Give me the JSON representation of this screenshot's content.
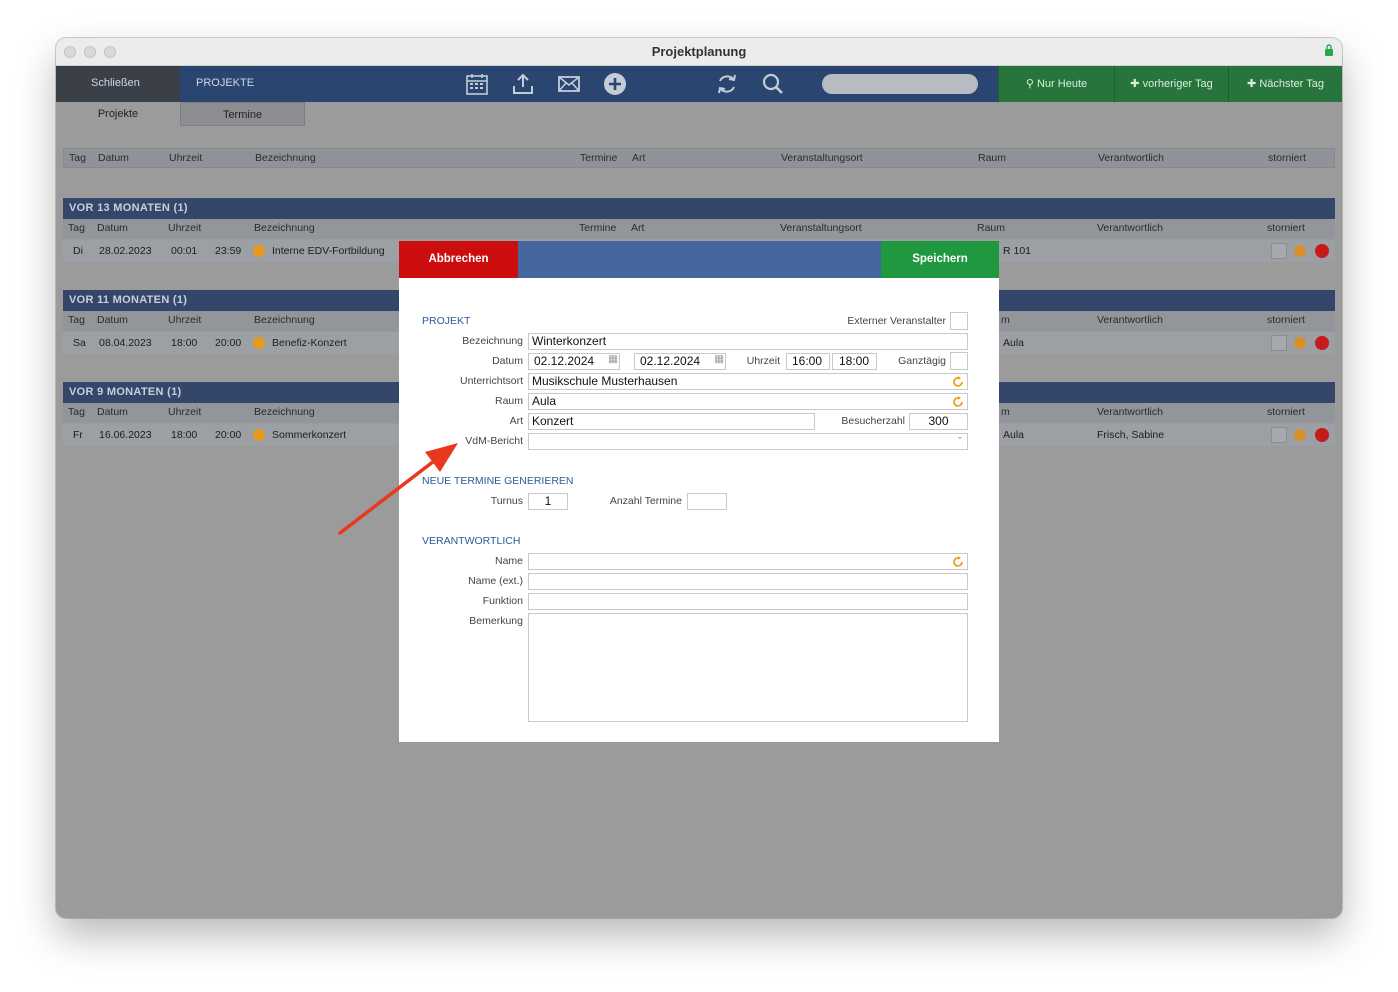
{
  "window": {
    "title": "Projektplanung"
  },
  "toolbar": {
    "close_label": "Schließen",
    "section_label": "PROJEKTE",
    "nur_heute": "Nur Heute",
    "prev_day": "vorheriger Tag",
    "next_day": "Nächster Tag",
    "search_placeholder": ""
  },
  "subtabs": {
    "projekte": "Projekte",
    "termine": "Termine"
  },
  "columns": {
    "tag": "Tag",
    "datum": "Datum",
    "uhrzeit": "Uhrzeit",
    "bezeichnung": "Bezeichnung",
    "termine": "Termine",
    "art": "Art",
    "veranstaltungsort": "Veranstaltungsort",
    "raum": "Raum",
    "verantwortlich": "Verantwortlich",
    "storniert": "storniert",
    "raum_clipped": "m"
  },
  "groups": [
    {
      "title": "VOR 13 MONATEN (1)",
      "row": {
        "tag": "Di",
        "datum": "28.02.2023",
        "start": "00:01",
        "end": "23:59",
        "bezeichnung": "Interne EDV-Fortbildung",
        "raum": "R 101",
        "verantwortlich": ""
      }
    },
    {
      "title": "VOR 11 MONATEN (1)",
      "row": {
        "tag": "Sa",
        "datum": "08.04.2023",
        "start": "18:00",
        "end": "20:00",
        "bezeichnung": "Benefiz-Konzert",
        "raum": "Aula",
        "verantwortlich": ""
      }
    },
    {
      "title": "VOR 9 MONATEN (1)",
      "row": {
        "tag": "Fr",
        "datum": "16.06.2023",
        "start": "18:00",
        "end": "20:00",
        "bezeichnung": "Sommerkonzert",
        "raum": "Aula",
        "verantwortlich": "Frisch, Sabine"
      }
    }
  ],
  "modal": {
    "cancel": "Abbrechen",
    "save": "Speichern",
    "section_projekt": "PROJEKT",
    "externer_label": "Externer Veranstalter",
    "bezeichnung_label": "Bezeichnung",
    "bezeichnung_value": "Winterkonzert",
    "datum_label": "Datum",
    "datum_from": "02.12.2024",
    "datum_to": "02.12.2024",
    "uhrzeit_label": "Uhrzeit",
    "uhrzeit_from": "16:00",
    "uhrzeit_to": "18:00",
    "ganztaegig_label": "Ganztägig",
    "unterrichtsort_label": "Unterrichtsort",
    "unterrichtsort_value": "Musikschule Musterhausen",
    "raum_label": "Raum",
    "raum_value": "Aula",
    "art_label": "Art",
    "art_value": "Konzert",
    "besucher_label": "Besucherzahl",
    "besucher_value": "300",
    "vdm_label": "VdM-Bericht",
    "vdm_value": "",
    "section_termine": "NEUE TERMINE GENERIEREN",
    "turnus_label": "Turnus",
    "turnus_value": "1",
    "anzahl_label": "Anzahl Termine",
    "anzahl_value": "",
    "section_verantwortlich": "VERANTWORTLICH",
    "name_label": "Name",
    "name_ext_label": "Name (ext.)",
    "funktion_label": "Funktion",
    "bemerkung_label": "Bemerkung"
  },
  "colors": {
    "cancel": "#cc0d0d",
    "save": "#1f9840",
    "header_blue": "#45679e",
    "group_header": "#34476b",
    "refresh_orange": "#f0a020",
    "arrow_red": "#e8391f"
  }
}
